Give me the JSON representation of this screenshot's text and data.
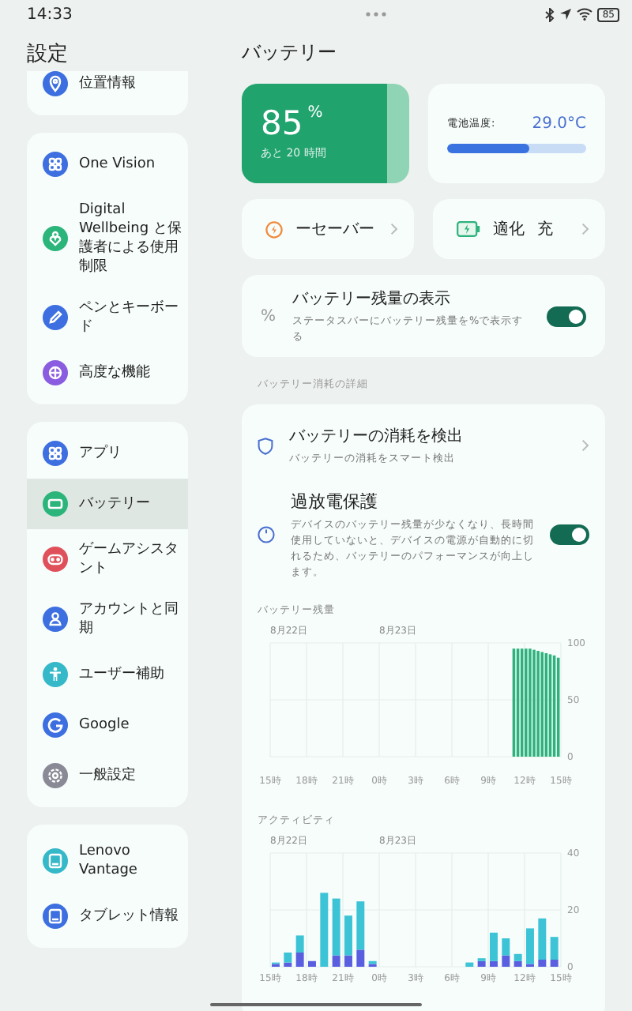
{
  "status_bar": {
    "time": "14:33",
    "battery": "85"
  },
  "sidebar": {
    "title": "設定",
    "groups": [
      {
        "items": [
          {
            "label": "位置情報",
            "color": "#3d6fe0",
            "selected": false
          }
        ]
      },
      {
        "items": [
          {
            "label": "One Vision",
            "color": "#3d6fe0",
            "selected": false
          },
          {
            "label": "Digital Wellbeing と保護者による使用制限",
            "color": "#2bb57a",
            "selected": false
          },
          {
            "label": "ペンとキーボード",
            "color": "#3d6fe0",
            "selected": false
          },
          {
            "label": "高度な機能",
            "color": "#8a5ce0",
            "selected": false
          }
        ]
      },
      {
        "items": [
          {
            "label": "アプリ",
            "color": "#3d6fe0",
            "selected": false
          },
          {
            "label": "バッテリー",
            "color": "#2bb57a",
            "selected": true
          },
          {
            "label": "ゲームアシスタント",
            "color": "#e0505a",
            "selected": false
          },
          {
            "label": "アカウントと同期",
            "color": "#3d6fe0",
            "selected": false
          },
          {
            "label": "ユーザー補助",
            "color": "#35b8c8",
            "selected": false
          },
          {
            "label": "Google",
            "color": "#3d6fe0",
            "selected": false
          },
          {
            "label": "一般設定",
            "color": "#8a8a96",
            "selected": false
          }
        ]
      },
      {
        "items": [
          {
            "label": "Lenovo Vantage",
            "color": "#35b8c8",
            "selected": false
          },
          {
            "label": "タブレット情報",
            "color": "#3d6fe0",
            "selected": false
          }
        ]
      }
    ]
  },
  "page": {
    "title": "バッテリー",
    "battery": {
      "percent": "85",
      "unit": "%",
      "remaining": "あと 20 時間",
      "level": 0.87
    },
    "temperature": {
      "label": "電池温度:",
      "value": "29.0°C",
      "level": 0.59
    },
    "shortcuts": [
      {
        "kind": "saver",
        "texts": [
          "ーセーバー"
        ]
      },
      {
        "kind": "optimize",
        "texts": [
          "適化",
          "充"
        ]
      }
    ],
    "percentage": {
      "icon": "%",
      "title": "バッテリー残量の表示",
      "subtitle": "ステータスバーにバッテリー残量を%で表示する",
      "on": true
    },
    "section_label": "バッテリー消耗の詳細",
    "details": [
      {
        "kind": "link",
        "title": "バッテリーの消耗を検出",
        "subtitle": "バッテリーの消耗をスマート検出"
      },
      {
        "kind": "toggle",
        "title": "過放電保護",
        "subtitle": "デバイスのバッテリー残量が少なくなり、長時間使用していないと、デバイスの電源が自動的に切れるため、バッテリーのパフォーマンスが向上します。",
        "on": true
      }
    ],
    "charts": [
      {
        "chart_data": {
          "type": "bar",
          "title": "バッテリー残量",
          "categories": [
            "15時",
            null,
            null,
            null,
            null,
            null,
            null,
            null,
            null,
            "18時",
            null,
            null,
            null,
            null,
            null,
            null,
            null,
            null,
            "21時",
            null,
            null,
            null,
            null,
            null,
            null,
            null,
            null,
            "0時",
            null,
            null,
            null,
            null,
            null,
            null,
            null,
            null,
            "3時",
            null,
            null,
            null,
            null,
            null,
            null,
            null,
            null,
            "6時",
            null,
            null,
            null,
            null,
            null,
            null,
            null,
            null,
            "9時",
            null,
            null,
            null,
            null,
            null,
            null,
            null,
            null,
            "12時",
            null,
            null,
            null,
            null,
            null,
            null,
            null,
            null,
            "15時"
          ],
          "series": [
            {
              "color": "#2eb27d",
              "values": [
                null,
                null,
                null,
                null,
                null,
                null,
                null,
                null,
                null,
                null,
                null,
                null,
                null,
                null,
                null,
                null,
                null,
                null,
                null,
                null,
                null,
                null,
                null,
                null,
                null,
                null,
                null,
                null,
                null,
                null,
                null,
                null,
                null,
                null,
                null,
                null,
                null,
                null,
                null,
                null,
                null,
                null,
                null,
                null,
                null,
                null,
                null,
                null,
                null,
                null,
                null,
                null,
                null,
                null,
                null,
                null,
                null,
                null,
                null,
                null,
                95,
                95,
                95,
                95,
                95,
                94,
                93,
                92,
                91,
                90,
                89,
                87,
                null
              ]
            }
          ],
          "ylim": [
            0,
            100
          ],
          "grid": true,
          "yticks": [
            0,
            50,
            100
          ],
          "annotations": [
            "8月22日",
            "8月23日"
          ]
        }
      },
      {
        "chart_data": {
          "type": "bar",
          "title": "アクティビティ",
          "stacked": true,
          "categories": [
            "15時",
            null,
            null,
            "18時",
            null,
            null,
            "21時",
            null,
            null,
            "0時",
            null,
            null,
            "3時",
            null,
            null,
            "6時",
            null,
            null,
            "9時",
            null,
            null,
            "12時",
            null,
            null,
            "15時"
          ],
          "series": [
            {
              "color": "#5a5fe0",
              "values": [
                1,
                1.5,
                5,
                2,
                0,
                4,
                4,
                6,
                1,
                null,
                null,
                null,
                null,
                null,
                null,
                null,
                0,
                2,
                2,
                4,
                2,
                1,
                2.5,
                2.5,
                null
              ]
            },
            {
              "color": "#3cc4d6",
              "values": [
                0.5,
                3.5,
                6,
                0,
                26,
                20,
                14,
                17,
                1,
                null,
                null,
                null,
                null,
                null,
                null,
                null,
                1.5,
                1,
                10,
                6,
                2.5,
                12.5,
                14.5,
                8,
                null
              ]
            }
          ],
          "ylim": [
            0,
            40
          ],
          "grid": true,
          "yticks": [
            0,
            20,
            40
          ],
          "annotations": [
            "8月22日",
            "8月23日"
          ]
        }
      }
    ]
  }
}
